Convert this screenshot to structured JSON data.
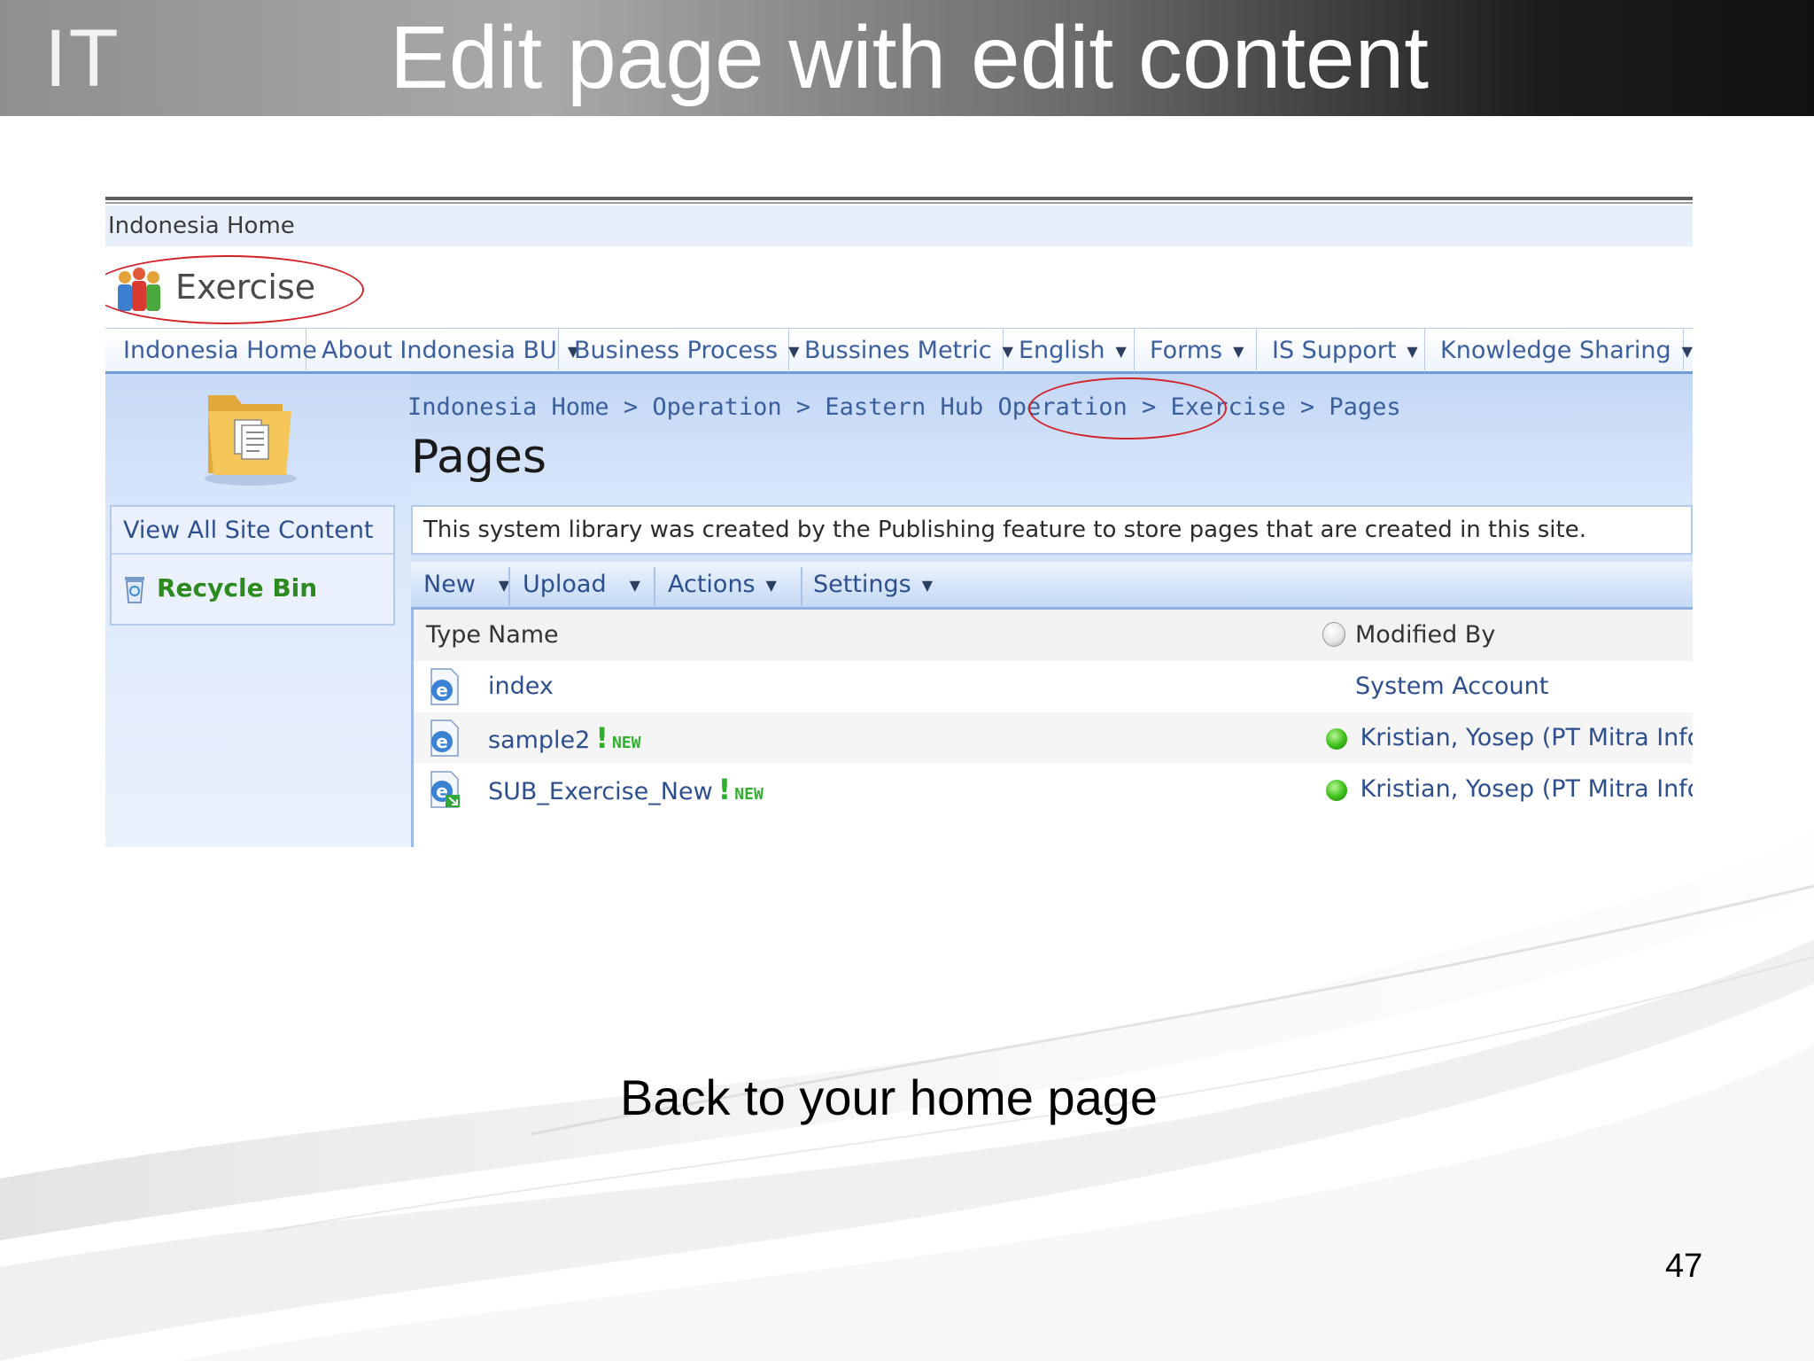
{
  "slide": {
    "logo_text": "IT",
    "title": "Edit page with edit content",
    "caption": "Back to your home page",
    "page_number": "47",
    "header_gradient": [
      "#8f8f8f",
      "#111111"
    ]
  },
  "sharepoint": {
    "global_bar": "Indonesia Home",
    "site_title": "Exercise",
    "top_nav": [
      {
        "label": "Indonesia Home",
        "has_menu": false
      },
      {
        "label": "About Indonesia BU",
        "has_menu": true
      },
      {
        "label": "Business Process",
        "has_menu": true
      },
      {
        "label": "Bussines Metric",
        "has_menu": true
      },
      {
        "label": "English",
        "has_menu": true
      },
      {
        "label": "Forms",
        "has_menu": true
      },
      {
        "label": "IS Support",
        "has_menu": true
      },
      {
        "label": "Knowledge Sharing",
        "has_menu": true
      }
    ],
    "breadcrumb": "Indonesia Home > Operation > Eastern Hub Operation > Exercise > Pages",
    "page_title": "Pages",
    "quick_launch": {
      "view_all": "View All Site Content",
      "recycle_bin": "Recycle Bin"
    },
    "description": "This system library was created by the Publishing feature to store pages that are created in this site.",
    "toolbar": {
      "new": "New",
      "upload": "Upload",
      "actions": "Actions",
      "settings": "Settings"
    },
    "list": {
      "headers": {
        "type": "Type",
        "name": "Name",
        "modified_by": "Modified By"
      },
      "rows": [
        {
          "name": "index",
          "is_new": false,
          "new_mark": "",
          "new_tag": "",
          "modified_by": "System Account",
          "presence": false,
          "icon": "ie-page-icon"
        },
        {
          "name": "sample2",
          "is_new": true,
          "new_mark": "!",
          "new_tag": "NEW",
          "modified_by": "Kristian, Yosep (PT Mitra Infoparama)",
          "presence": true,
          "icon": "ie-page-icon"
        },
        {
          "name": "SUB_Exercise_New",
          "is_new": true,
          "new_mark": "!",
          "new_tag": "NEW",
          "modified_by": "Kristian, Yosep (PT Mitra Infoparama)",
          "presence": true,
          "icon": "ie-page-link-icon"
        }
      ]
    },
    "colors": {
      "link": "#2d4f8e",
      "nav_text": "#3b5f9c",
      "new_green": "#2fb02d",
      "highlight_ellipse": "#d2232a"
    }
  }
}
